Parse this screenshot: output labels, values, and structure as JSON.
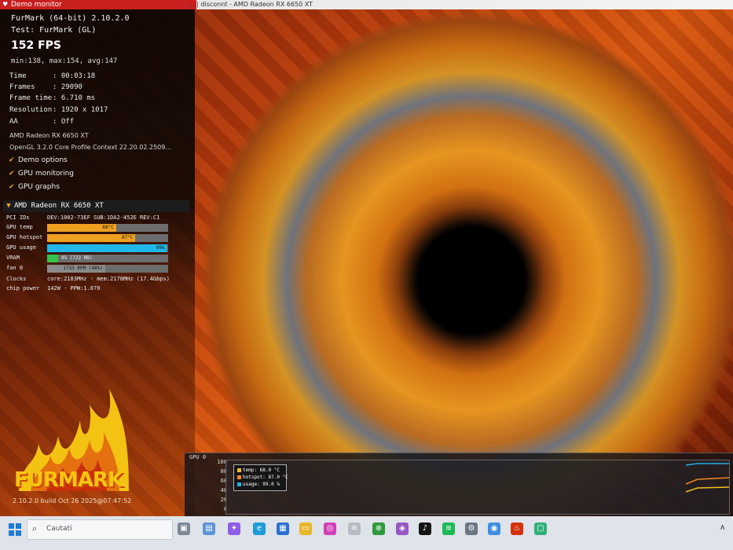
{
  "window": {
    "title": "Demo monitor",
    "caption_text": "... | disconnt - AMD Radeon RX 6650 XT"
  },
  "overlay": {
    "app_title": "FurMark (64-bit) 2.10.2.0",
    "test_name": "Test: FurMark (GL)",
    "fps": "152 FPS",
    "minmax": "min:138, max:154, avg:147",
    "stats": [
      {
        "key": "Time",
        "value": ": 00:03:18"
      },
      {
        "key": "Frames",
        "value": ": 29090"
      },
      {
        "key": "Frame time",
        "value": ": 6.710 ms"
      },
      {
        "key": "Resolution",
        "value": ": 1920 x 1017"
      },
      {
        "key": "AA",
        "value": ": Off"
      }
    ],
    "gpu_model": "AMD Radeon RX 6650 XT",
    "gl_context": "OpenGL 3.2.0 Core Profile Context 22.20.02.2509...",
    "options": [
      {
        "label": "Demo options",
        "checked": true
      },
      {
        "label": "GPU monitoring",
        "checked": true
      },
      {
        "label": "GPU graphs",
        "checked": true
      }
    ]
  },
  "monitor": {
    "header": "AMD Radeon RX 6650 XT",
    "pci_label": "PCI IDs",
    "pci_value": "DEV:1002-73EF SUB:1DA2-452E REV:C1",
    "rows": [
      {
        "label": "GPU temp",
        "text": "68°C",
        "fraction": 0.57,
        "color": "#f0a020"
      },
      {
        "label": "GPU hotspot",
        "text": "87°C",
        "fraction": 0.73,
        "color": "#f0a020"
      },
      {
        "label": "GPU usage",
        "text": "99%",
        "fraction": 0.99,
        "color": "#1fb8e8"
      },
      {
        "label": "VRAM",
        "text": "9% (722 MB)",
        "fraction": 0.09,
        "color": "#35c24a"
      },
      {
        "label": "fan 0",
        "text": "1733 RPM (48%)",
        "fraction": 0.48,
        "color": "#8a8a8a"
      }
    ],
    "clocks_label": "Clocks",
    "clocks_value": "core:2183MHz - mem:2178MHz (17.4Gbps)",
    "power_label": "chip power",
    "power_value": "142W - PPW:1.070"
  },
  "branding": {
    "logo_text": "FURMARK",
    "build": "2.10.2.0 build Oct 26 2025@07:47:52"
  },
  "graph": {
    "title": "GPU 0",
    "y_ticks": [
      "100",
      "80",
      "60",
      "40",
      "20",
      "0"
    ],
    "legend": [
      {
        "label": "temp: 68.0 °C",
        "color": "#f0c020"
      },
      {
        "label": "hotspot: 87.0 °C",
        "color": "#f08a20"
      },
      {
        "label": "usage: 99.0 %",
        "color": "#20b0e8"
      }
    ]
  },
  "taskbar": {
    "search_placeholder": "Cautati",
    "icons": [
      "task-view-icon",
      "widgets-icon",
      "copilot-icon",
      "edge-icon",
      "store-icon",
      "file-explorer-icon",
      "app-pink-icon",
      "notepad-icon",
      "xbox-icon",
      "app-purple-icon",
      "tiktok-icon",
      "spotify-icon",
      "settings-icon",
      "chrome-icon",
      "furmark-icon",
      "app-green-icon"
    ]
  }
}
